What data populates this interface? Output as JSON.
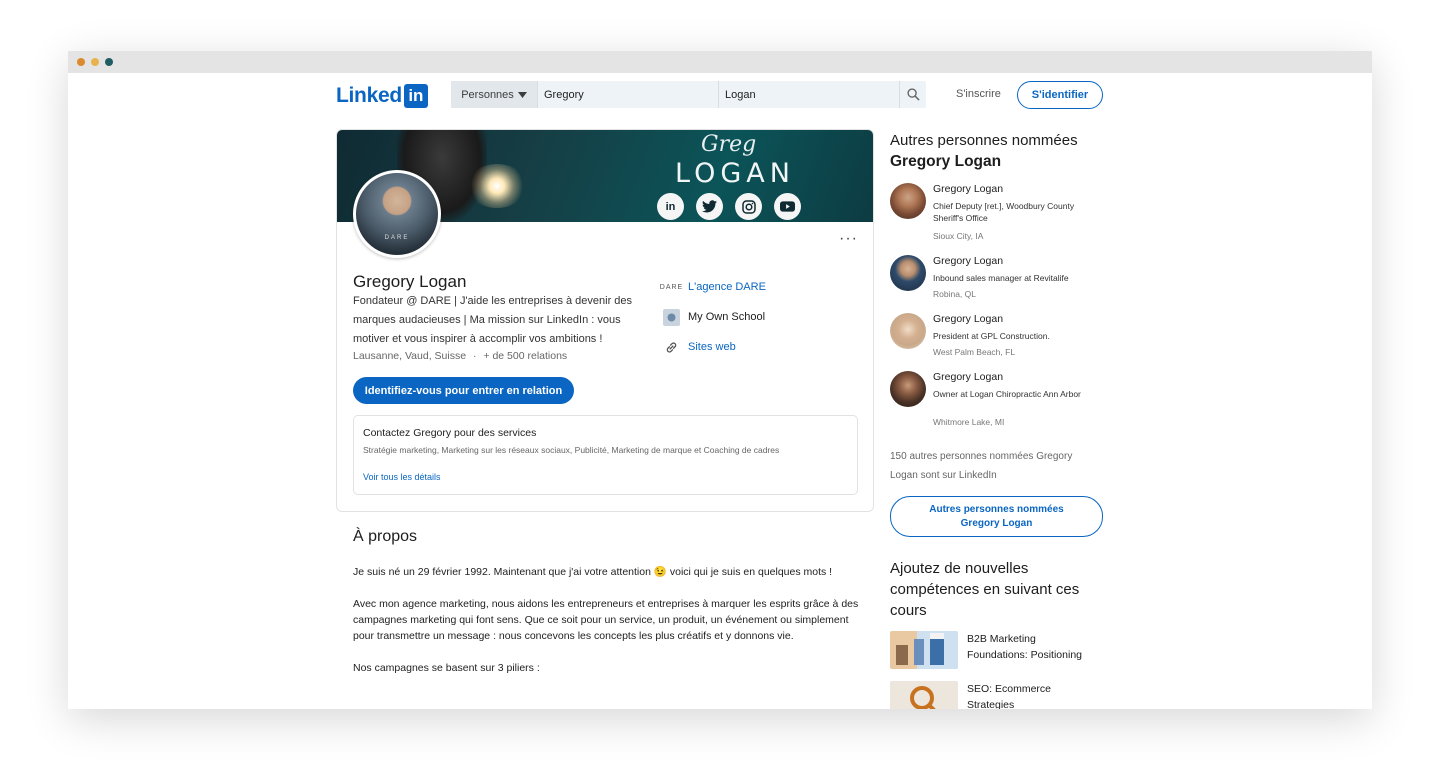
{
  "window": {
    "dots": [
      "#dc8a2e",
      "#e8b34a",
      "#1f5c64"
    ]
  },
  "nav": {
    "logo_text": "Linked",
    "logo_box": "in",
    "search_scope": "Personnes",
    "first_name_value": "Gregory",
    "last_name_value": "Logan",
    "join_label": "S'inscrire",
    "signin_label": "S'identifier"
  },
  "banner": {
    "script": "Greg",
    "title": "LOGAN",
    "socials": [
      "in",
      "t",
      "ig",
      "yt"
    ]
  },
  "profile": {
    "avatar_text": "DARE",
    "more": "···",
    "name": "Gregory Logan",
    "headline": "Fondateur @ DARE | J'aide les entreprises à devenir des marques audacieuses | Ma mission sur LinkedIn : vous motiver et vous inspirer à accomplir vos ambitions !",
    "location": "Lausanne, Vaud, Suisse",
    "separator": "·",
    "connections": "+ de 500 relations",
    "cta": "Identifiez-vous pour entrer en relation",
    "links": [
      {
        "label": "L'agence DARE",
        "icon": "dare-logo-icon",
        "glyph": "DARE"
      },
      {
        "label": "My Own School",
        "icon": "school-logo-icon",
        "glyph": ""
      },
      {
        "label": "Sites web",
        "icon": "link-icon",
        "glyph": "🔗"
      }
    ],
    "services": {
      "title": "Contactez Gregory pour des services",
      "list": "Stratégie marketing, Marketing sur les réseaux sociaux, Publicité, Marketing de marque et Coaching de cadres",
      "link": "Voir tous les détails"
    }
  },
  "about": {
    "title": "À propos",
    "p1": "Je suis né un 29 février 1992. Maintenant que j'ai votre attention 😉 voici qui je suis en quelques mots !",
    "p2": "Avec mon agence marketing, nous aidons les entrepreneurs et entreprises à marquer les esprits grâce à des campagnes marketing qui font sens. Que ce soit pour un service, un produit, un événement ou simplement pour transmettre un message : nous concevons les concepts les plus créatifs et y donnons vie.",
    "p3": "Nos campagnes se basent sur 3 piliers :"
  },
  "others": {
    "title_line1": "Autres personnes nommées",
    "title_line2": "Gregory Logan",
    "people": [
      {
        "name": "Gregory Logan",
        "title": "Chief Deputy [ret.], Woodbury County Sheriff's Office",
        "location": "Sioux City, IA",
        "avatar_color": "#7a4a34"
      },
      {
        "name": "Gregory Logan",
        "title": "Inbound sales manager at Revitalife",
        "location": "Robina, QL",
        "avatar_color": "#2e4a6a"
      },
      {
        "name": "Gregory Logan",
        "title": "President at GPL Construction.",
        "location": "West Palm Beach, FL",
        "avatar_color": "#c9a88a"
      },
      {
        "name": "Gregory Logan",
        "title": "Owner at Logan Chiropractic Ann Arbor",
        "location": "Whitmore Lake, MI",
        "avatar_color": "#4a3226"
      }
    ],
    "more_text": "150 autres personnes nommées Gregory Logan sont sur LinkedIn",
    "button_line1": "Autres personnes nommées",
    "button_line2": "Gregory Logan"
  },
  "courses": {
    "title": "Ajoutez de nouvelles compétences en suivant ces cours",
    "items": [
      {
        "title": "B2B Marketing Foundations: Positioning",
        "thumb_color": "#e9c9a2"
      },
      {
        "title": "SEO: Ecommerce Strategies",
        "thumb_color": "#d9d2c6"
      }
    ]
  }
}
